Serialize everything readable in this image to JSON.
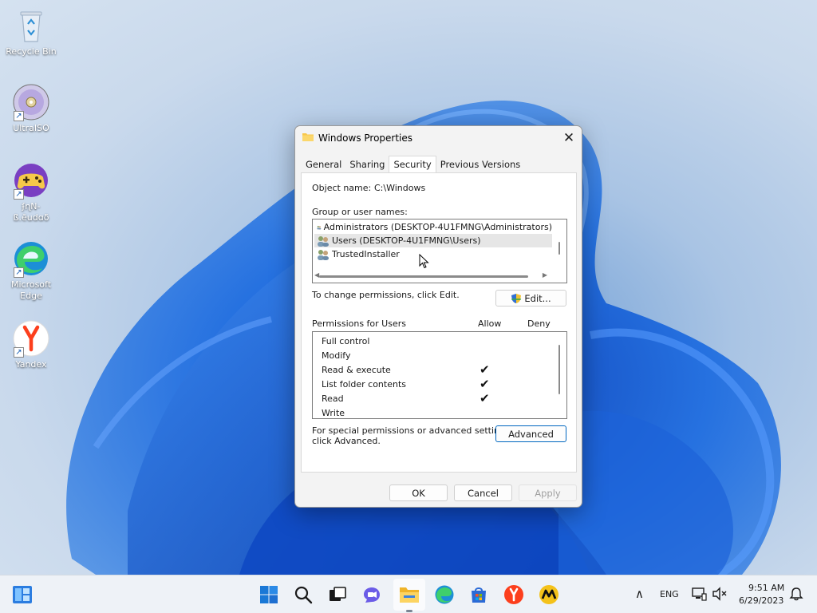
{
  "desktop": {
    "icons": [
      {
        "label": "Recycle Bin"
      },
      {
        "label": "UltraISO"
      },
      {
        "label": "ʄɳN-ß.ēudɑδ"
      },
      {
        "label": "Microsoft Edge"
      },
      {
        "label": "Yandex"
      }
    ]
  },
  "dialog": {
    "title": "Windows Properties",
    "close_label": "✕",
    "tabs": [
      {
        "label": "General"
      },
      {
        "label": "Sharing"
      },
      {
        "label": "Security"
      },
      {
        "label": "Previous Versions"
      }
    ],
    "active_tab": "Security",
    "object_name_label": "Object name:",
    "object_name_value": "C:\\Windows",
    "group_label": "Group or user names:",
    "users": [
      {
        "name": "Administrators (DESKTOP-4U1FMNG\\Administrators)"
      },
      {
        "name": "Users (DESKTOP-4U1FMNG\\Users)"
      },
      {
        "name": "TrustedInstaller"
      }
    ],
    "selected_user": "Users (DESKTOP-4U1FMNG\\Users)",
    "change_perm_text": "To change permissions, click Edit.",
    "edit_label": "Edit...",
    "permissions_for": "Permissions for Users",
    "allow_label": "Allow",
    "deny_label": "Deny",
    "permissions": [
      {
        "name": "Full control",
        "allow": false,
        "deny": false
      },
      {
        "name": "Modify",
        "allow": false,
        "deny": false
      },
      {
        "name": "Read & execute",
        "allow": true,
        "deny": false
      },
      {
        "name": "List folder contents",
        "allow": true,
        "deny": false
      },
      {
        "name": "Read",
        "allow": true,
        "deny": false
      },
      {
        "name": "Write",
        "allow": false,
        "deny": false
      }
    ],
    "advanced_text_line1": "For special permissions or advanced settings,",
    "advanced_text_line2": "click Advanced.",
    "advanced_label": "Advanced",
    "ok_label": "OK",
    "cancel_label": "Cancel",
    "apply_label": "Apply",
    "check_glyph": "✔"
  },
  "taskbar": {
    "language": "ENG",
    "time": "9:51 AM",
    "date": "6/29/2023",
    "chevron": "∧"
  },
  "colors": {
    "accent": "#0067c0",
    "yandex_red": "#fc3f1d",
    "folder_yellow": "#f8c74a"
  }
}
